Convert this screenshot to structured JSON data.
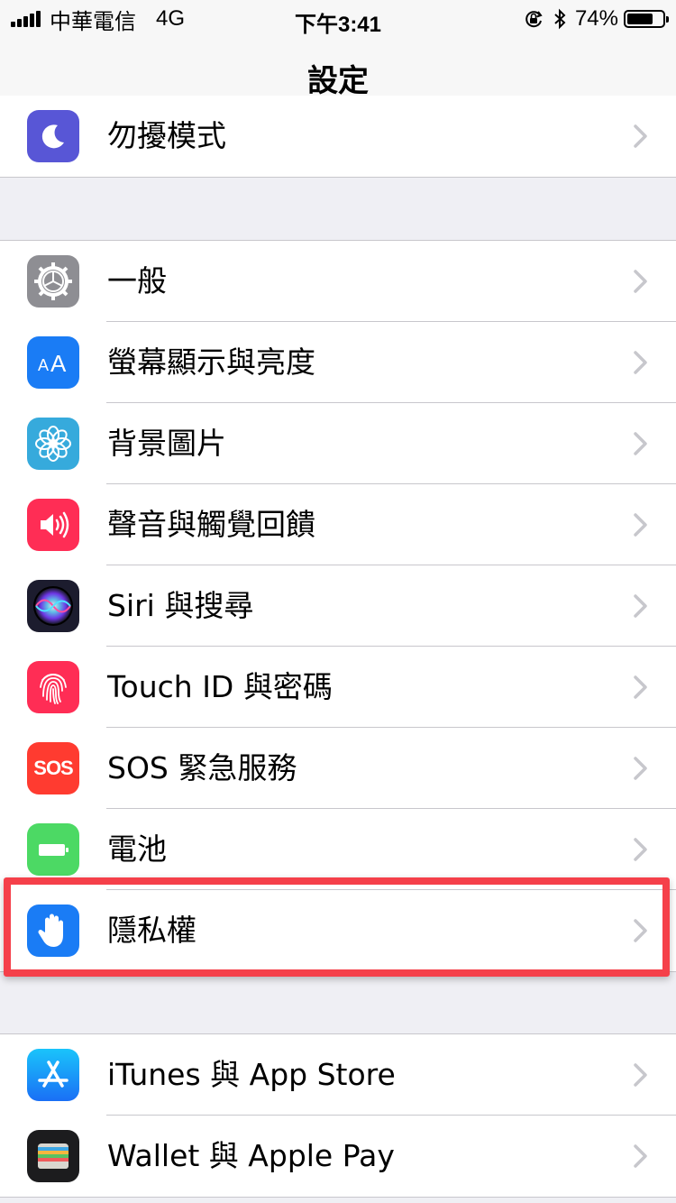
{
  "status_bar": {
    "carrier": "中華電信",
    "network": "4G",
    "time": "下午3:41",
    "battery_percent": "74%",
    "battery_level": 0.74
  },
  "nav": {
    "title": "設定"
  },
  "groups": [
    {
      "rows": [
        {
          "label": "勿擾模式",
          "icon": "moon-icon",
          "color": "#5856d6"
        }
      ]
    },
    {
      "rows": [
        {
          "label": "一般",
          "icon": "gear-icon",
          "color": "#8e8e93"
        },
        {
          "label": "螢幕顯示與亮度",
          "icon": "text-size-icon",
          "color": "#1a7cf5"
        },
        {
          "label": "背景圖片",
          "icon": "flower-icon",
          "color": "#36aadc"
        },
        {
          "label": "聲音與觸覺回饋",
          "icon": "speaker-icon",
          "color": "#ff2d55"
        },
        {
          "label": "Siri 與搜尋",
          "icon": "siri-icon",
          "color": "#1c1c2e"
        },
        {
          "label": "Touch ID 與密碼",
          "icon": "fingerprint-icon",
          "color": "#ff2d55"
        },
        {
          "label": "SOS 緊急服務",
          "icon": "sos-icon",
          "color": "#ff3b30",
          "icon_text": "SOS"
        },
        {
          "label": "電池",
          "icon": "battery-icon",
          "color": "#4cd964"
        },
        {
          "label": "隱私權",
          "icon": "hand-icon",
          "color": "#1a7cf5"
        }
      ]
    },
    {
      "rows": [
        {
          "label": "iTunes 與 App Store",
          "icon": "app-store-icon",
          "color": "#1a8cf5"
        },
        {
          "label": "Wallet 與 Apple Pay",
          "icon": "wallet-icon",
          "color": "#1c1c1e"
        }
      ]
    }
  ]
}
